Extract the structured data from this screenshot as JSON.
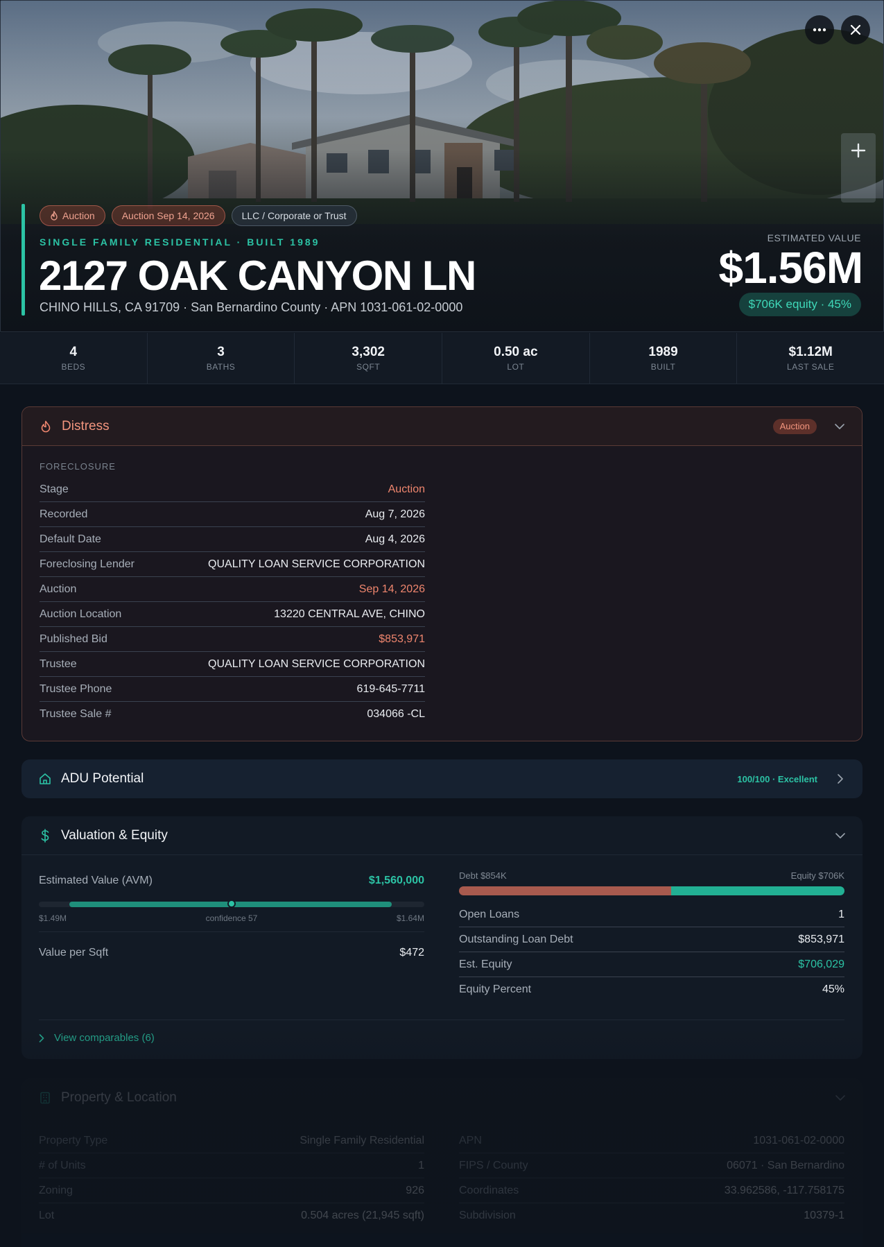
{
  "hero": {
    "chips": [
      {
        "label": "Auction",
        "icon": "flame-icon",
        "variant": "red"
      },
      {
        "label": "Auction Sep 14, 2026",
        "variant": "red"
      },
      {
        "label": "LLC / Corporate or Trust",
        "variant": "gray"
      }
    ],
    "subtitle": "SINGLE FAMILY RESIDENTIAL · BUILT 1989",
    "title": "2127 OAK CANYON LN",
    "address": "CHINO HILLS, CA 91709 · San Bernardino County · APN 1031-061-02-0000",
    "estimated_label": "ESTIMATED VALUE",
    "estimated_value": "$1.56M",
    "equity_pill": "$706K equity · 45%",
    "buttons": {
      "more_icon": "ellipsis-icon",
      "close_icon": "close-icon",
      "zoom_in_icon": "plus-icon"
    }
  },
  "stats": [
    {
      "value": "4",
      "label": "BEDS"
    },
    {
      "value": "3",
      "label": "BATHS"
    },
    {
      "value": "3,302",
      "label": "SQFT"
    },
    {
      "value": "0.50 ac",
      "label": "LOT"
    },
    {
      "value": "1989",
      "label": "BUILT"
    },
    {
      "value": "$1.12M",
      "label": "LAST SALE"
    }
  ],
  "distress": {
    "title": "Distress",
    "icon": "flame-icon",
    "badge": "Auction",
    "section_label": "FORECLOSURE",
    "rows": [
      {
        "key": "Stage",
        "value": "Auction",
        "tone": "red"
      },
      {
        "key": "Recorded",
        "value": "Aug 7, 2026",
        "tone": ""
      },
      {
        "key": "Default Date",
        "value": "Aug 4, 2026",
        "tone": ""
      },
      {
        "key": "Foreclosing Lender",
        "value": "QUALITY LOAN SERVICE CORPORATION",
        "tone": ""
      },
      {
        "key": "Auction",
        "value": "Sep 14, 2026",
        "tone": "red"
      },
      {
        "key": "Auction Location",
        "value": "13220 CENTRAL AVE, CHINO",
        "tone": ""
      },
      {
        "key": "Published Bid",
        "value": "$853,971",
        "tone": "red"
      },
      {
        "key": "Trustee",
        "value": "QUALITY LOAN SERVICE CORPORATION",
        "tone": ""
      },
      {
        "key": "Trustee Phone",
        "value": "619-645-7711",
        "tone": ""
      },
      {
        "key": "Trustee Sale #",
        "value": "034066 -CL",
        "tone": ""
      }
    ]
  },
  "adu": {
    "title": "ADU Potential",
    "icon": "home-icon",
    "badge": "100/100 · Excellent"
  },
  "valuation": {
    "title": "Valuation & Equity",
    "icon": "dollar-icon",
    "avm_label": "Estimated Value (AVM)",
    "avm_value": "$1,560,000",
    "range_low": "$1.49M",
    "range_high": "$1.64M",
    "confidence": "confidence 57",
    "avm_bar": {
      "fill_start": 0.08,
      "fill_end": 0.915,
      "marker": 0.5
    },
    "vps_label": "Value per Sqft",
    "vps_value": "$472",
    "debt_label": "Debt $854K",
    "equity_label": "Equity $706K",
    "debt_fraction": 0.55,
    "rows": [
      {
        "key": "Open Loans",
        "value": "1",
        "tone": ""
      },
      {
        "key": "Outstanding Loan Debt",
        "value": "$853,971",
        "tone": ""
      },
      {
        "key": "Est. Equity",
        "value": "$706,029",
        "tone": "green"
      },
      {
        "key": "Equity Percent",
        "value": "45%",
        "tone": ""
      }
    ],
    "comparables": "View comparables (6)"
  },
  "property": {
    "title": "Property & Location",
    "icon": "building-icon",
    "left_rows": [
      {
        "key": "Property Type",
        "value": "Single Family Residential"
      },
      {
        "key": "# of Units",
        "value": "1"
      },
      {
        "key": "Zoning",
        "value": "926"
      },
      {
        "key": "Lot",
        "value": "0.504 acres (21,945 sqft)"
      }
    ],
    "right_rows": [
      {
        "key": "APN",
        "value": "1031-061-02-0000"
      },
      {
        "key": "FIPS / County",
        "value": "06071 · San Bernardino"
      },
      {
        "key": "Coordinates",
        "value": "33.962586, -117.758175"
      },
      {
        "key": "Subdivision",
        "value": "10379-1"
      }
    ]
  },
  "colors": {
    "accent": "#2cc3a5",
    "alert": "#ef866e",
    "background": "#0d131c"
  }
}
